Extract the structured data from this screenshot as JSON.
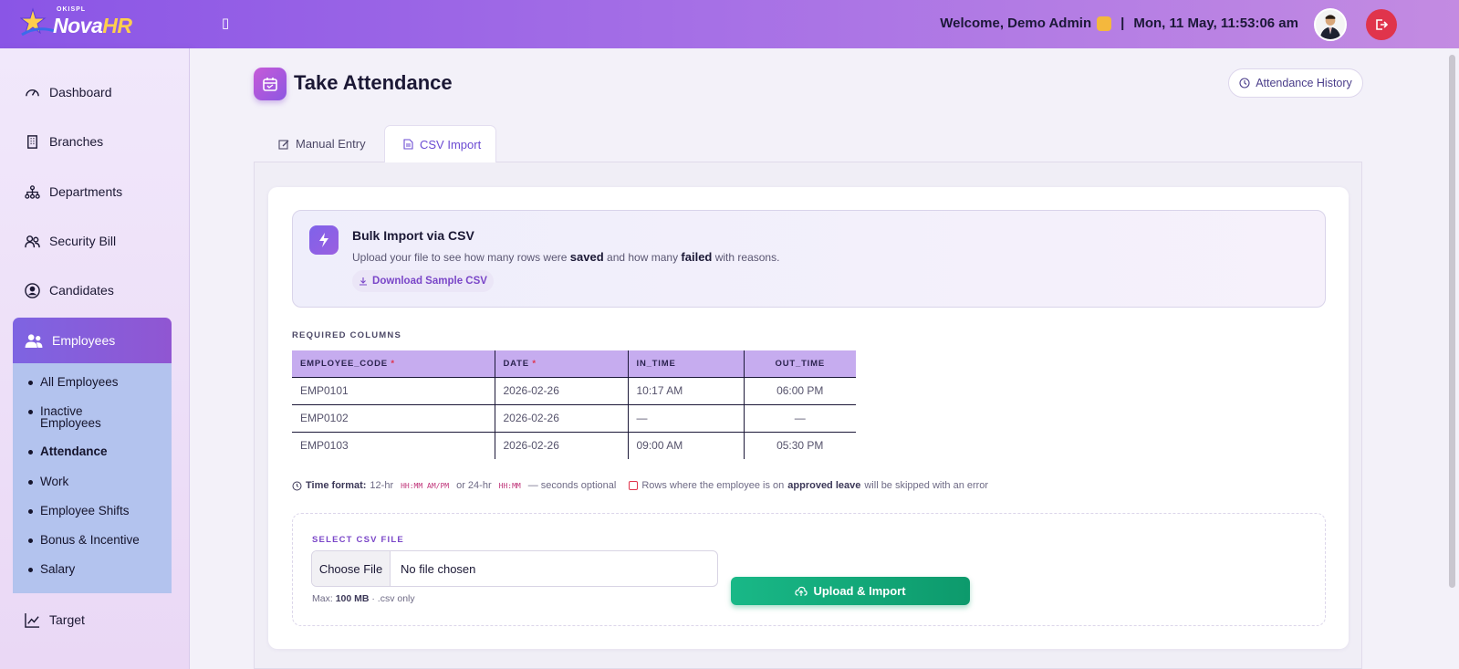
{
  "brand": {
    "small": "OKISPL",
    "name_part1": "Nova",
    "name_part2": "HR"
  },
  "topbar": {
    "menu_toggle": "▯",
    "welcome": "Welcome, Demo Admin",
    "datetime": "Mon, 11 May, 11:53:06 am",
    "separator": "|"
  },
  "sidebar": {
    "items": [
      {
        "label": "Dashboard",
        "icon": "gauge-icon"
      },
      {
        "label": "Branches",
        "icon": "building-icon"
      },
      {
        "label": "Departments",
        "icon": "org-chart-icon"
      },
      {
        "label": "Security Bill",
        "icon": "users-icon"
      },
      {
        "label": "Candidates",
        "icon": "user-circle-icon"
      },
      {
        "label": "Employees",
        "icon": "employees-icon"
      },
      {
        "label": "Target",
        "icon": "trend-icon"
      }
    ],
    "employees_submenu": [
      "All Employees",
      "Inactive Employees",
      "Attendance",
      "Work",
      "Employee Shifts",
      "Bonus & Incentive",
      "Salary"
    ]
  },
  "page": {
    "title": "Take Attendance",
    "history_button": "Attendance History",
    "tabs": {
      "manual": "Manual Entry",
      "csv": "CSV Import"
    }
  },
  "bulk": {
    "title": "Bulk Import via CSV",
    "desc_1": "Upload your file to see how many rows were",
    "desc_saved": "saved",
    "desc_2": "and how many",
    "desc_failed": "failed",
    "desc_3": "with reasons.",
    "download": "Download Sample CSV"
  },
  "required": {
    "label": "REQUIRED COLUMNS",
    "columns": [
      "EMPLOYEE_CODE",
      "DATE",
      "IN_TIME",
      "OUT_TIME"
    ],
    "star": "*",
    "rows": [
      [
        "EMP0101",
        "2026-02-26",
        "10:17 AM",
        "06:00 PM"
      ],
      [
        "EMP0102",
        "2026-02-26",
        "—",
        "—"
      ],
      [
        "EMP0103",
        "2026-02-26",
        "09:00 AM",
        "05:30 PM"
      ]
    ]
  },
  "hint": {
    "time_label": "Time format:",
    "t12": "12-hr",
    "fmt12": "HH:MM AM/PM",
    "or24": "or 24-hr",
    "fmt24": "HH:MM",
    "seconds": "— seconds optional",
    "leave_1": "Rows where the employee is on",
    "leave_bold": "approved leave",
    "leave_2": "will be skipped with an error"
  },
  "upload": {
    "label": "SELECT CSV FILE",
    "choose": "Choose File",
    "no_file": "No file chosen",
    "max_prefix": "Max:",
    "max_size": "100 MB",
    "max_suffix": "· .csv only",
    "button": "Upload & Import"
  },
  "colors": {
    "accent": "#8a55e6",
    "tab_active": "#6b4bd3",
    "success": "#10a874",
    "danger": "#e0344c",
    "table_header": "#c6acef"
  }
}
